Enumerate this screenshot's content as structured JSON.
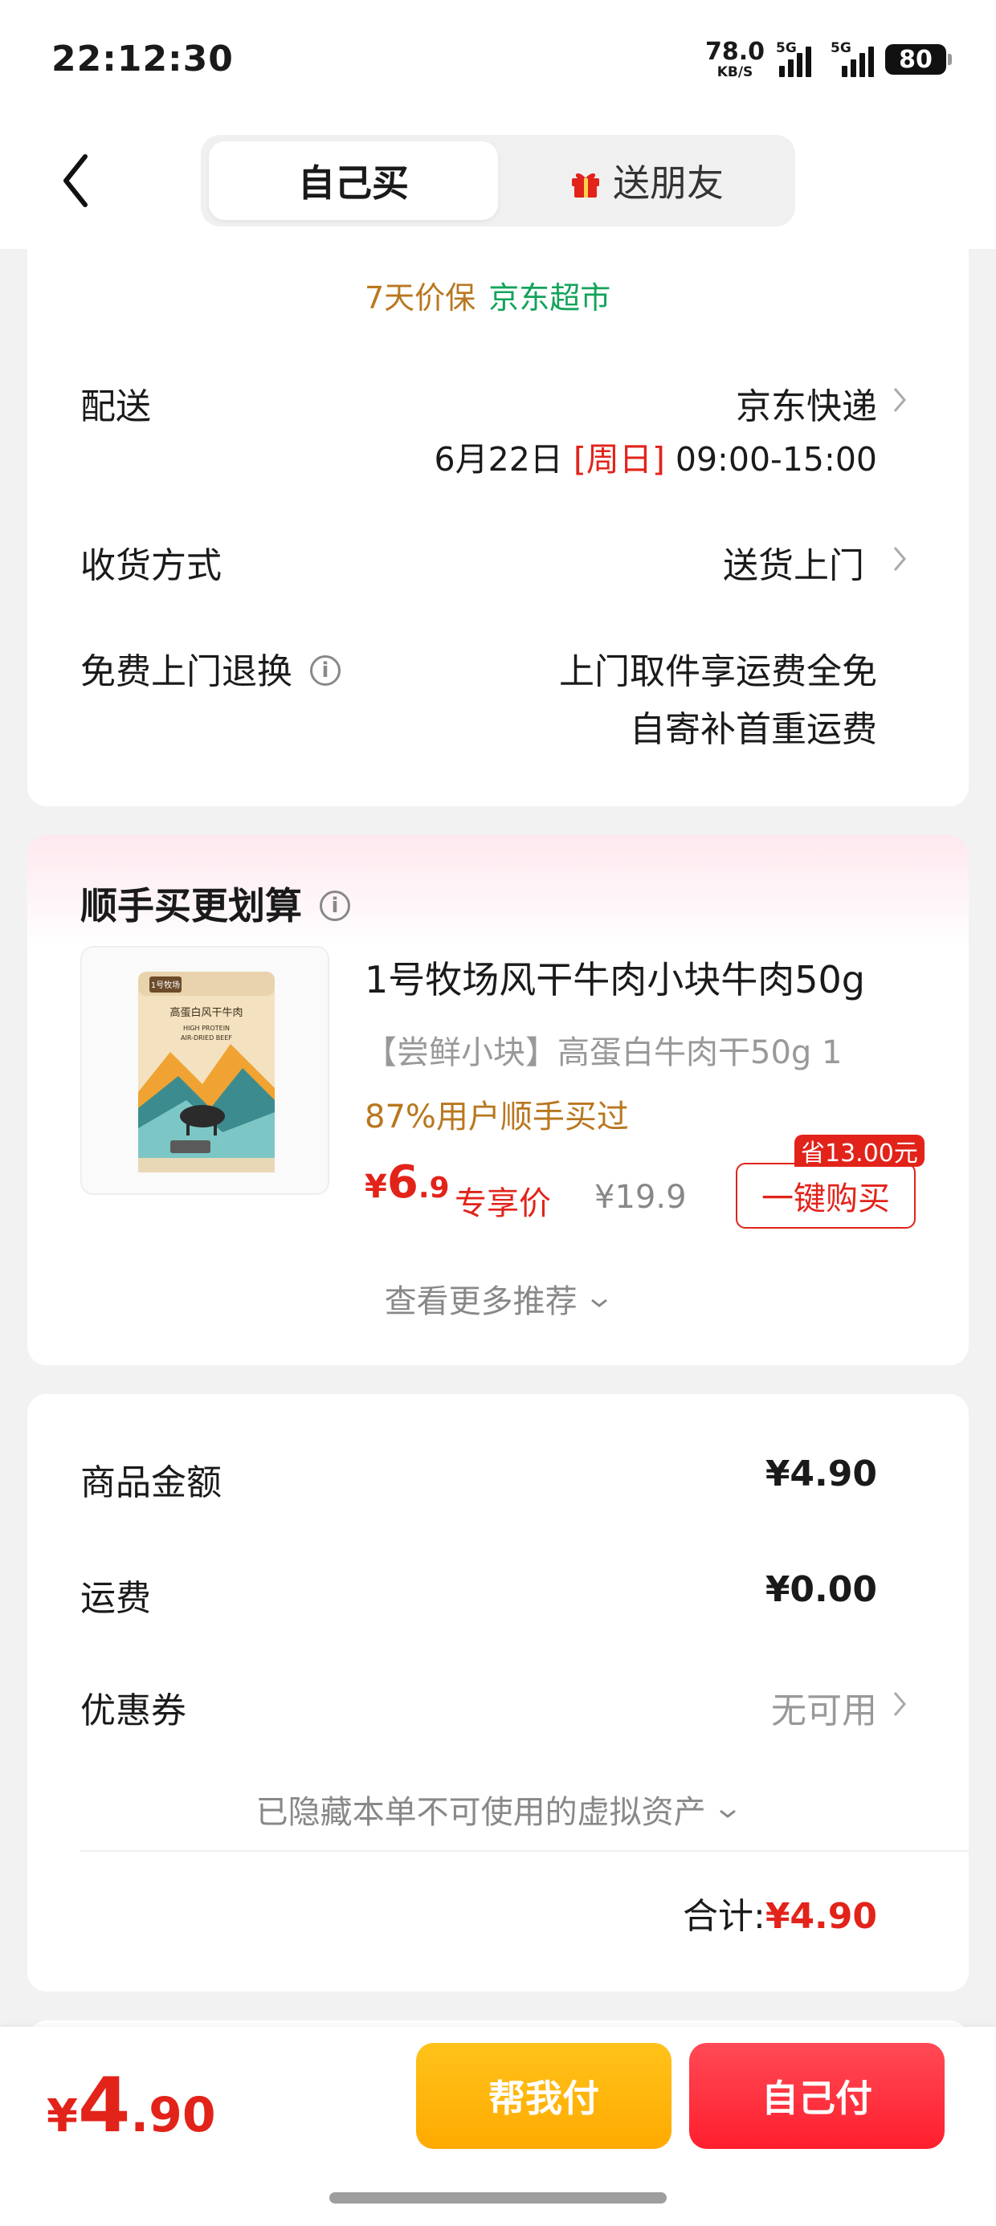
{
  "status_bar": {
    "time": "22:12:30",
    "net_speed": "78.0",
    "net_unit": "KB/S",
    "sim1": "5G",
    "sim2": "5G",
    "battery": "80"
  },
  "header": {
    "tab_self": "自己买",
    "tab_gift": "送朋友",
    "back_icon": "chevron-left-icon",
    "gift_icon": "gift-icon"
  },
  "delivery": {
    "tag_price_protect": "7天价保",
    "tag_store": "京东超市",
    "shipping_label": "配送",
    "shipping_value": "京东快递",
    "date_prefix": "6月22日",
    "date_weekday": "[周日]",
    "date_time": "09:00-15:00",
    "receive_label": "收货方式",
    "receive_value": "送货上门",
    "return_label": "免费上门退换",
    "return_line1": "上门取件享运费全免",
    "return_line2": "自寄补首重运费"
  },
  "recommend": {
    "title": "顺手买更划算",
    "product_name": "1号牧场风干牛肉小块牛肉50g",
    "product_desc": "【尝鲜小块】高蛋白牛肉干50g 1",
    "buy_rate": "87%用户顺手买过",
    "price_currency": "¥",
    "price_int": "6",
    "price_dec": ".9",
    "exclusive_label": "专享价",
    "original_price": "¥19.9",
    "save_badge": "省13.00元",
    "buy_button": "一键购买",
    "more_label": "查看更多推荐",
    "package_title": "高蛋白风干牛肉",
    "package_sub1": "HIGH PROTEIN",
    "package_sub2": "AIR-DRIED BEEF",
    "package_brand": "1号牧场"
  },
  "summary": {
    "goods_label": "商品金额",
    "goods_value": "¥4.90",
    "freight_label": "运费",
    "freight_value": "¥0.00",
    "coupon_label": "优惠券",
    "coupon_value": "无可用",
    "hidden_note": "已隐藏本单不可使用的虚拟资产",
    "total_label": "合计:",
    "total_value": "¥4.90"
  },
  "bottom": {
    "price_currency": "¥",
    "price_int": "4",
    "price_dec": ".90",
    "help_pay": "帮我付",
    "self_pay": "自己付"
  },
  "colors": {
    "accent_red": "#e2231a",
    "price_gold": "#b9771f",
    "store_green": "#13a35a",
    "help_btn": "#ffb300",
    "self_btn": "#ff2a3a"
  }
}
